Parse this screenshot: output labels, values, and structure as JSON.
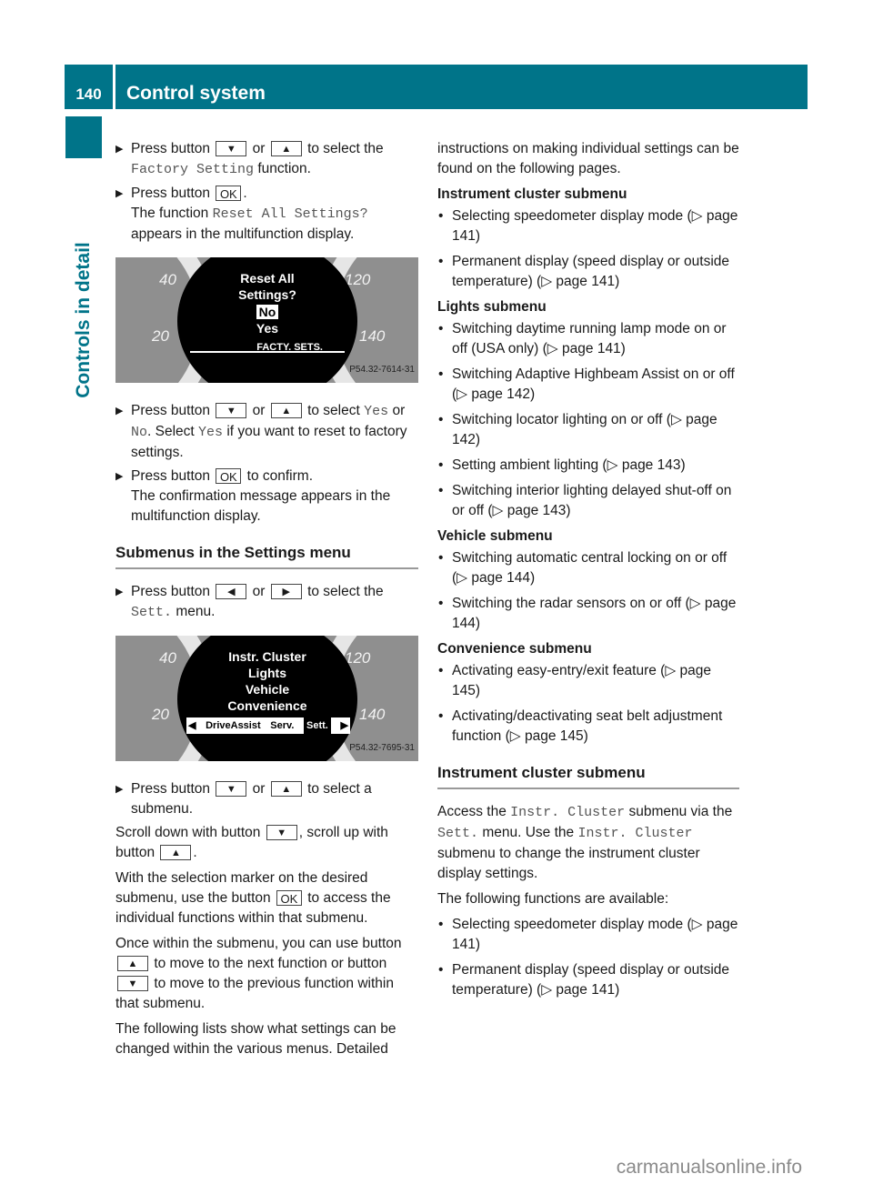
{
  "header": {
    "page_number": "140",
    "title": "Control system"
  },
  "side_tab": {
    "label": "Controls in detail"
  },
  "left_column": {
    "step1": {
      "pre": "Press button",
      "key_down": "▼",
      "or": "or",
      "key_up": "▲",
      "post": "to select the",
      "mono": "Factory Setting",
      "tail": "function."
    },
    "step2": {
      "pre": "Press button",
      "key_ok": "OK",
      "post": ".",
      "line2_pre": "The function",
      "line2_mono": "Reset All Settings?",
      "line3": "appears in the multifunction display."
    },
    "figure1": {
      "gauge_labels": [
        "40",
        "20",
        "120",
        "140"
      ],
      "screen_lines": [
        "Reset All",
        "Settings?"
      ],
      "options": [
        "No",
        "Yes"
      ],
      "selected_option": "No",
      "footer_label": "FACTY. SETS.",
      "figure_id": "P54.32-7614-31"
    },
    "step3": {
      "pre": "Press button",
      "key_down": "▼",
      "or": "or",
      "key_up": "▲",
      "mid": "to select",
      "yes": "Yes",
      "or2": "or",
      "no": "No",
      "mid2": ". Select",
      "yes2": "Yes",
      "post": "if you want to reset to factory settings."
    },
    "step4": {
      "pre": "Press button",
      "key_ok": "OK",
      "post": "to confirm.",
      "line2": "The confirmation message appears in the multifunction display."
    },
    "section_title": "Submenus in the Settings menu",
    "step5": {
      "pre": "Press button",
      "key_left": "◀",
      "or": "or",
      "key_right": "▶",
      "post": "to select the",
      "mono": "Sett.",
      "tail": "menu."
    },
    "figure2": {
      "gauge_labels": [
        "40",
        "20",
        "120",
        "140"
      ],
      "screen_lines": [
        "Instr. Cluster",
        "Lights",
        "Vehicle",
        "Convenience"
      ],
      "menu_items": [
        "DriveAssist",
        "Serv.",
        "Sett."
      ],
      "active_menu": "Sett.",
      "figure_id": "P54.32-7695-31"
    },
    "step6": {
      "pre": "Press button",
      "key_down": "▼",
      "or": "or",
      "key_up": "▲",
      "post": "to select a submenu."
    },
    "para1": {
      "pre": "Scroll down with button",
      "key_down": "▼",
      "mid": ", scroll up with button",
      "key_up": "▲",
      "post": "."
    },
    "para2": {
      "pre": "With the selection marker on the desired submenu, use the button",
      "key_ok": "OK",
      "post": "to access the individual functions within that submenu."
    },
    "para3": {
      "pre": "Once within the submenu, you can use button",
      "key_up": "▲",
      "mid": "to move to the next function or button",
      "key_down": "▼",
      "post": "to move to the previous function within that submenu."
    },
    "para4": "The following lists show what settings can be changed within the various menus. Detailed"
  },
  "right_column": {
    "intro": "instructions on making individual settings can be found on the following pages.",
    "groups": [
      {
        "title": "Instrument cluster submenu",
        "items": [
          "Selecting speedometer display mode (▷ page 141)",
          "Permanent display (speed display or outside temperature) (▷ page 141)"
        ]
      },
      {
        "title": "Lights submenu",
        "items": [
          "Switching daytime running lamp mode on or off (USA only) (▷ page 141)",
          "Switching Adaptive Highbeam Assist on or off (▷ page 142)",
          "Switching locator lighting on or off (▷ page 142)",
          "Setting ambient lighting (▷ page 143)",
          "Switching interior lighting delayed shut-off on or off (▷ page 143)"
        ]
      },
      {
        "title": "Vehicle submenu",
        "items": [
          "Switching automatic central locking on or off (▷ page 144)",
          "Switching the radar sensors on or off (▷ page 144)"
        ]
      },
      {
        "title": "Convenience submenu",
        "items": [
          "Activating easy-entry/exit feature (▷ page 145)",
          "Activating/deactivating seat belt adjustment function (▷ page 145)"
        ]
      }
    ],
    "section_title": "Instrument cluster submenu",
    "access": {
      "t1": "Access the",
      "m1": "Instr. Cluster",
      "t2": "submenu via the",
      "m2": "Sett.",
      "t3": "menu. Use the",
      "m3": "Instr. Cluster",
      "t4": "submenu to change the instrument cluster display settings."
    },
    "functions_intro": "The following functions are available:",
    "functions": [
      "Selecting speedometer display mode (▷ page 141)",
      "Permanent display (speed display or outside temperature) (▷ page 141)"
    ]
  },
  "footer": {
    "watermark": "carmanualsonline.info"
  }
}
